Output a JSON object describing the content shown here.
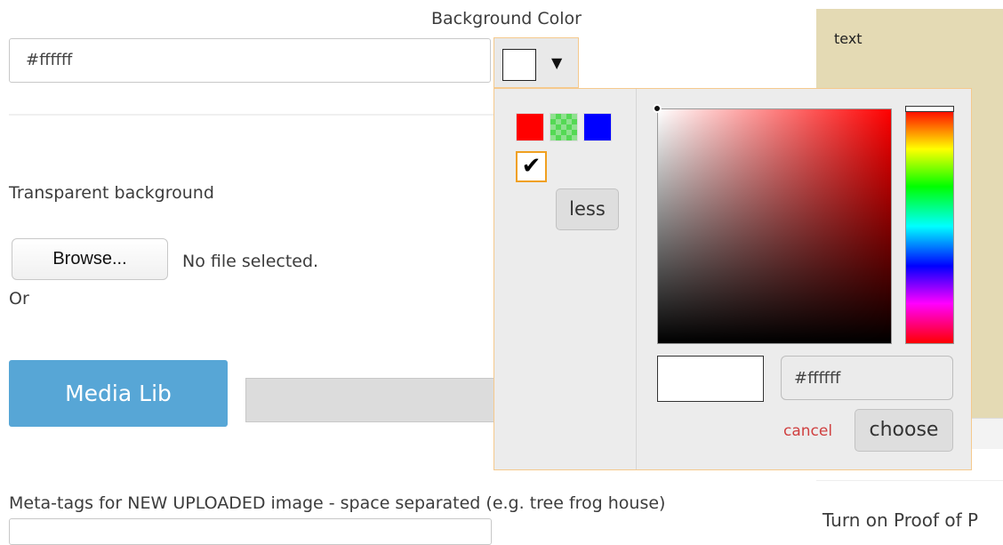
{
  "background_color": {
    "label": "Background Color",
    "input_value": "#ffffff",
    "trigger_arrow": "▼",
    "trigger_swatch_color": "#ffffff"
  },
  "transparent": {
    "label": "Transparent background"
  },
  "file_upload": {
    "browse_label": "Browse...",
    "status": "No file selected.",
    "or_label": "Or"
  },
  "media_lib": {
    "button_label": "Media Lib"
  },
  "meta_tags": {
    "label": "Meta-tags for NEW UPLOADED image - space separated (e.g. tree frog house)",
    "value": ""
  },
  "side_panel": {
    "preview_text": "text",
    "proof_label": "Turn on Proof of P"
  },
  "color_picker": {
    "palette": [
      {
        "name": "red",
        "color": "#ff0000"
      },
      {
        "name": "transparent",
        "color": "transparent"
      },
      {
        "name": "blue",
        "color": "#0000ff"
      }
    ],
    "selected_check": "✔",
    "less_label": "less",
    "hex_value": "#ffffff",
    "preview_color": "#ffffff",
    "cancel_label": "cancel",
    "choose_label": "choose"
  }
}
